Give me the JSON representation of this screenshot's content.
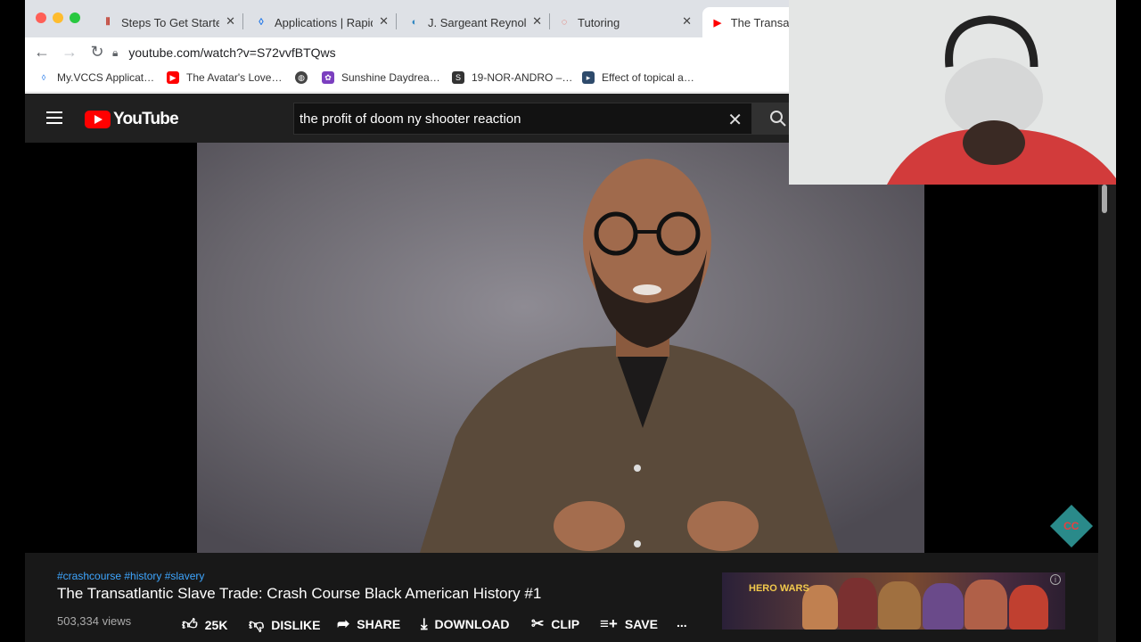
{
  "browser": {
    "tabs": [
      {
        "title": "Steps To Get Starte",
        "icon": "steps-icon"
      },
      {
        "title": "Applications | Rapid",
        "icon": "applications-icon"
      },
      {
        "title": "J. Sargeant Reynold",
        "icon": "jsr-icon"
      },
      {
        "title": "Tutoring",
        "icon": "tutoring-icon"
      },
      {
        "title": "The Transat",
        "icon": "youtube-icon"
      }
    ],
    "url": "youtube.com/watch?v=S72vvfBTQws",
    "bookmarks": [
      {
        "label": "My.VCCS Applicat…",
        "icon": "vccs-icon",
        "color": "#1a73e8"
      },
      {
        "label": "The Avatar's Love…",
        "icon": "youtube-icon",
        "color": "#ff0000"
      },
      {
        "label": "",
        "icon": "globe-icon",
        "color": "#5f6368"
      },
      {
        "label": "Sunshine Daydrea…",
        "icon": "bookmark-app-icon",
        "color": "#7b3fbf"
      },
      {
        "label": "19-NOR-ANDRO –…",
        "icon": "supplement-icon",
        "color": "#333333"
      },
      {
        "label": "Effect of topical a…",
        "icon": "article-icon",
        "color": "#2e4a6b"
      }
    ]
  },
  "youtube": {
    "logo_text": "YouTube",
    "search_query": "the profit of doom ny shooter reaction",
    "video": {
      "hashtags": "#crashcourse #history #slavery",
      "title": "The Transatlantic Slave Trade: Crash Course Black American History #1",
      "views": "503,334 views",
      "watermark": "CC"
    },
    "actions": {
      "like": "25K",
      "dislike": "DISLIKE",
      "share": "SHARE",
      "download": "DOWNLOAD",
      "clip": "CLIP",
      "save": "SAVE",
      "more": "..."
    },
    "ad": {
      "logo": "HERO WARS"
    }
  },
  "colors": {
    "youtube_red": "#ff0000",
    "link_blue": "#3ea6ff",
    "dark_bg": "#181818"
  }
}
